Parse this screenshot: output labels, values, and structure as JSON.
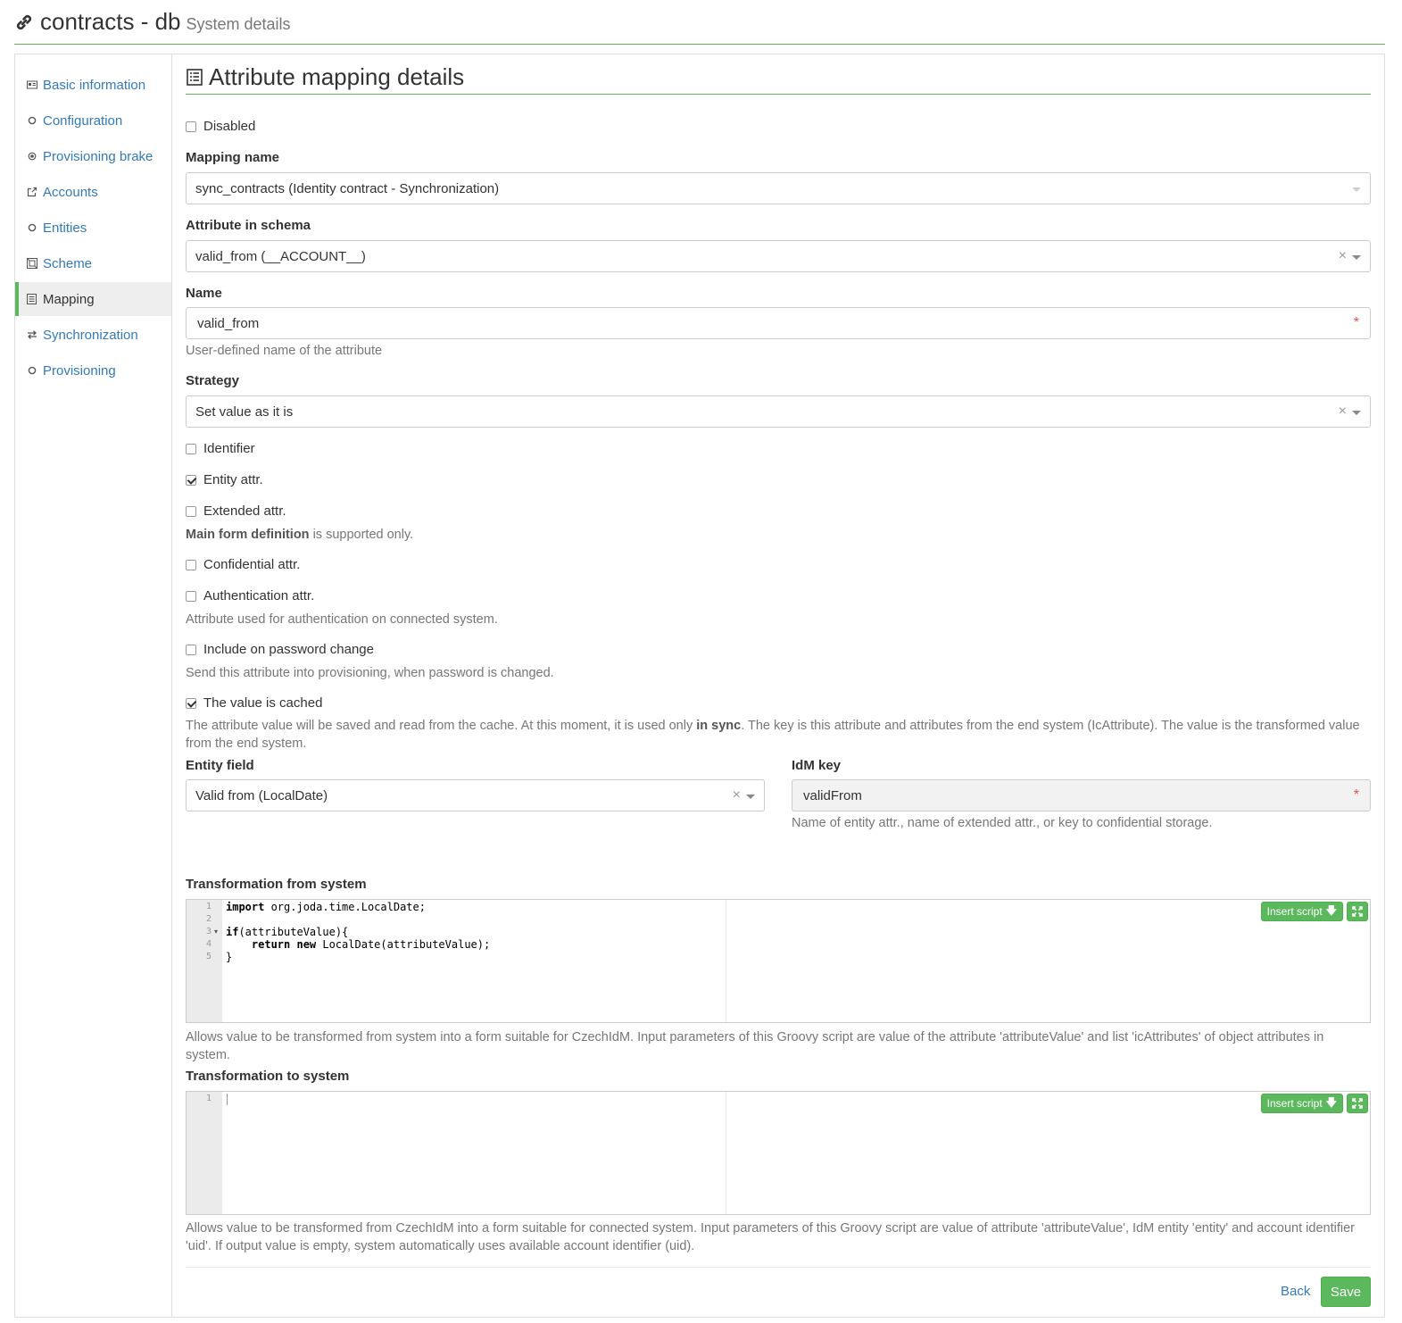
{
  "header": {
    "title": "contracts - db",
    "subtitle": "System details",
    "icon": "link-icon"
  },
  "sidebar": {
    "items": [
      {
        "label": "Basic information",
        "icon": "id-card-icon"
      },
      {
        "label": "Configuration",
        "icon": "circle-icon"
      },
      {
        "label": "Provisioning brake",
        "icon": "dot-circle-icon"
      },
      {
        "label": "Accounts",
        "icon": "external-link-icon"
      },
      {
        "label": "Entities",
        "icon": "circle-icon"
      },
      {
        "label": "Scheme",
        "icon": "schema-icon"
      },
      {
        "label": "Mapping",
        "icon": "list-icon",
        "active": true
      },
      {
        "label": "Synchronization",
        "icon": "exchange-icon"
      },
      {
        "label": "Provisioning",
        "icon": "circle-icon"
      }
    ]
  },
  "main": {
    "section_title": "Attribute mapping details",
    "disabled_label": "Disabled",
    "mapping_name_label": "Mapping name",
    "mapping_name_value": "sync_contracts (Identity contract - Synchronization)",
    "attr_schema_label": "Attribute in schema",
    "attr_schema_value": "valid_from (__ACCOUNT__)",
    "name_label": "Name",
    "name_value": "valid_from",
    "name_help": "User-defined name of the attribute",
    "strategy_label": "Strategy",
    "strategy_value": "Set value as it is",
    "identifier_label": "Identifier",
    "entity_attr_label": "Entity attr.",
    "extended_attr_label": "Extended attr.",
    "extended_help_bold": "Main form definition",
    "extended_help_rest": " is supported only.",
    "confidential_label": "Confidential attr.",
    "authentication_label": "Authentication attr.",
    "authentication_help": "Attribute used for authentication on connected system.",
    "password_change_label": "Include on password change",
    "password_change_help": "Send this attribute into provisioning, when password is changed.",
    "cached_label": "The value is cached",
    "cached_help_1": "The attribute value will be saved and read from the cache. At this moment, it is used only ",
    "cached_help_bold": "in sync",
    "cached_help_2": ". The key is this attribute and attributes from the end system (IcAttribute). The value is the transformed value from the end system.",
    "entity_field_label": "Entity field",
    "entity_field_value": "Valid from (LocalDate)",
    "idm_key_label": "IdM key",
    "idm_key_value": "validFrom",
    "idm_key_help": "Name of entity attr., name of extended attr., or key to confidential storage.",
    "transform_from_label": "Transformation from system",
    "transform_from_code": {
      "line_numbers": [
        "1",
        "2",
        "3",
        "4",
        "5"
      ],
      "lines": [
        {
          "kw": "import",
          "rest": " org.joda.time.LocalDate;"
        },
        {
          "kw": "",
          "rest": ""
        },
        {
          "kw": "if",
          "rest": "(attributeValue){"
        },
        {
          "indent": "    ",
          "kw": "return new",
          "rest": " LocalDate(attributeValue);"
        },
        {
          "kw": "",
          "rest": "}"
        }
      ]
    },
    "transform_from_help": "Allows value to be transformed from system into a form suitable for CzechIdM. Input parameters of this Groovy script are value of the attribute 'attributeValue' and list 'icAttributes' of object attributes in system.",
    "transform_to_label": "Transformation to system",
    "transform_to_line_numbers": [
      "1"
    ],
    "transform_to_help": "Allows value to be transformed from CzechIdM into a form suitable for connected system. Input parameters of this Groovy script are value of attribute 'attributeValue', IdM entity 'entity' and account identifier 'uid'. If output value is empty, system automatically uses available account identifier (uid).",
    "insert_script_label": "Insert script",
    "required_mark": "*",
    "clear_mark": "×",
    "back_label": "Back",
    "save_label": "Save"
  },
  "colors": {
    "accent": "#5cb85c",
    "link": "#337ab7",
    "required": "#d9534f"
  }
}
